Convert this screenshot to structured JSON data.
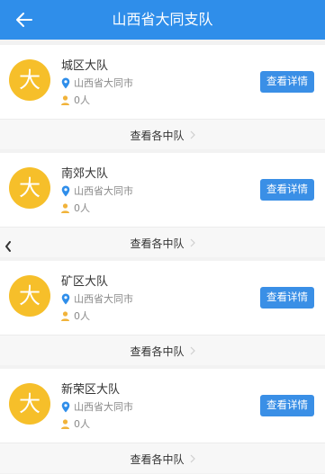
{
  "header": {
    "title": "山西省大同支队"
  },
  "units": [
    {
      "avatar": "大",
      "name": "城区大队",
      "location": "山西省大同市",
      "count": "0人",
      "detail_label": "查看详情",
      "sub_label": "查看各中队"
    },
    {
      "avatar": "大",
      "name": "南郊大队",
      "location": "山西省大同市",
      "count": "0人",
      "detail_label": "查看详情",
      "sub_label": "查看各中队"
    },
    {
      "avatar": "大",
      "name": "矿区大队",
      "location": "山西省大同市",
      "count": "0人",
      "detail_label": "查看详情",
      "sub_label": "查看各中队"
    },
    {
      "avatar": "大",
      "name": "新荣区大队",
      "location": "山西省大同市",
      "count": "0人",
      "detail_label": "查看详情",
      "sub_label": "查看各中队"
    }
  ],
  "icons": {
    "back": "back-arrow-icon",
    "location": "map-pin-icon",
    "person": "person-icon",
    "chevron": "chevron-right-icon",
    "handle": "chevron-left-icon"
  },
  "colors": {
    "header_bg": "#2f8eea",
    "button_bg": "#3a8fe6",
    "avatar_bg": "#f6bf2a",
    "pin": "#2f8eea",
    "person": "#f1b33a"
  }
}
